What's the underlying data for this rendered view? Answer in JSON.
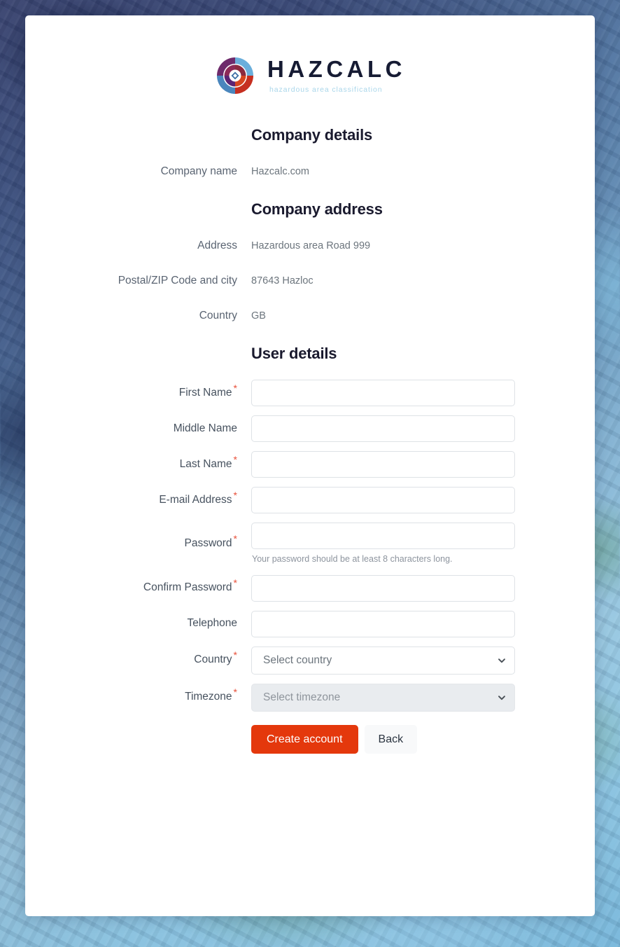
{
  "brand": {
    "logo_icon": "hazcalc-target-logo-icon",
    "wordmark": "HAZCALC",
    "tagline": "hazardous area classification",
    "wordmark_color": "#161b33",
    "tagline_color": "#a9d6ea"
  },
  "company_details": {
    "heading": "Company details",
    "rows": [
      {
        "label": "Company name",
        "value": "Hazcalc.com"
      }
    ]
  },
  "company_address": {
    "heading": "Company address",
    "rows": [
      {
        "label": "Address",
        "value": "Hazardous area Road 999"
      },
      {
        "label": "Postal/ZIP Code and city",
        "value": "87643 Hazloc"
      },
      {
        "label": "Country",
        "value": "GB"
      }
    ]
  },
  "user_details": {
    "heading": "User details",
    "required_marker": "*",
    "fields": [
      {
        "label": "First Name",
        "required": true,
        "value": "",
        "placeholder": "",
        "type": "text"
      },
      {
        "label": "Middle Name",
        "required": false,
        "value": "",
        "placeholder": "",
        "type": "text"
      },
      {
        "label": "Last Name",
        "required": true,
        "value": "",
        "placeholder": "",
        "type": "text"
      },
      {
        "label": "E-mail Address",
        "required": true,
        "value": "",
        "placeholder": "",
        "type": "email"
      },
      {
        "label": "Password",
        "required": true,
        "value": "",
        "placeholder": "",
        "type": "password",
        "help": "Your password should be at least 8 characters long."
      },
      {
        "label": "Confirm Password",
        "required": true,
        "value": "",
        "placeholder": "",
        "type": "password"
      },
      {
        "label": "Telephone",
        "required": false,
        "value": "",
        "placeholder": "",
        "type": "tel"
      },
      {
        "label": "Country",
        "required": true,
        "selected": "Select country",
        "type": "select",
        "disabled": false
      },
      {
        "label": "Timezone",
        "required": true,
        "selected": "Select timezone",
        "type": "select",
        "disabled": true
      }
    ]
  },
  "actions": {
    "primary_label": "Create account",
    "secondary_label": "Back",
    "primary_color": "#e4380c",
    "secondary_color": "#f8f9fa"
  }
}
